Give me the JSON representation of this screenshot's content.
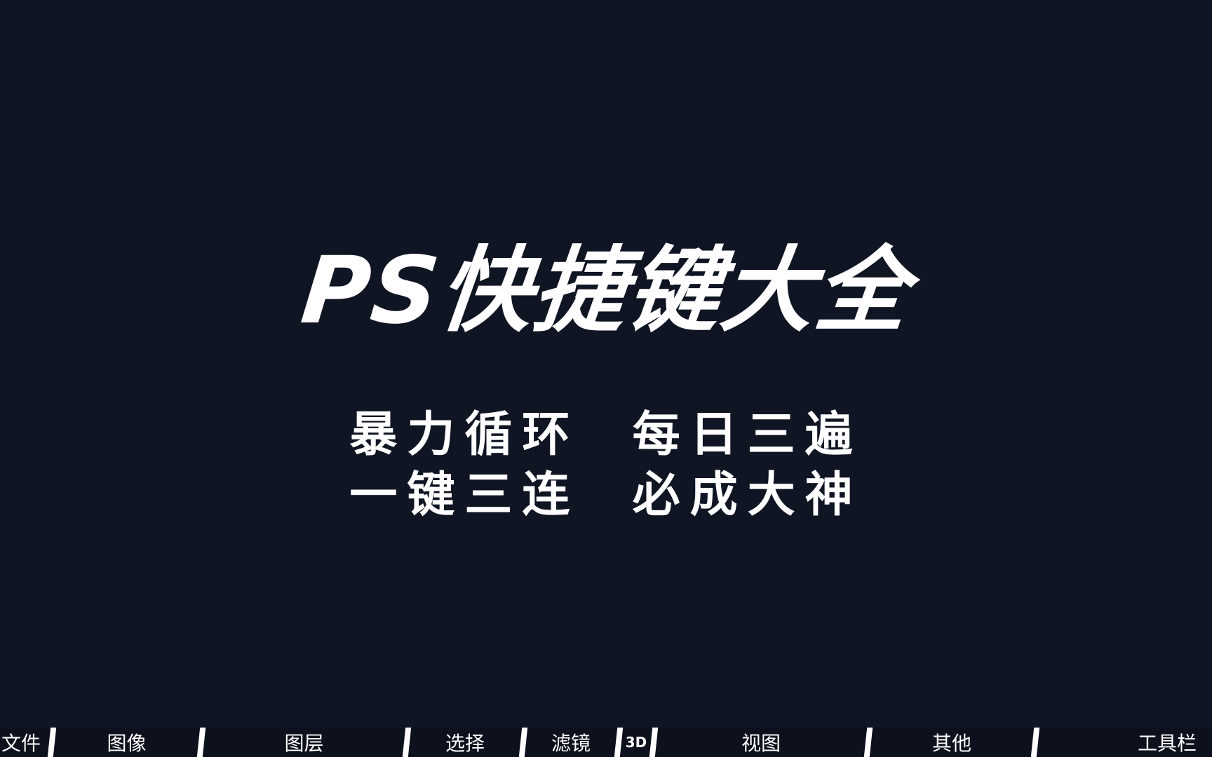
{
  "title": "PS快捷键大全",
  "slogans": [
    "暴力循环  每日三遍",
    "一键三连  必成大神"
  ],
  "timeline": {
    "segments": [
      {
        "label": "文件"
      },
      {
        "label": "图像"
      },
      {
        "label": "图层"
      },
      {
        "label": "选择"
      },
      {
        "label": "滤镜"
      },
      {
        "label": "3D"
      },
      {
        "label": "视图"
      },
      {
        "label": "其他"
      },
      {
        "label": "工具栏"
      }
    ]
  },
  "colors": {
    "background": "#0f1523",
    "text": "#ffffff",
    "divider": "#ffffff"
  }
}
